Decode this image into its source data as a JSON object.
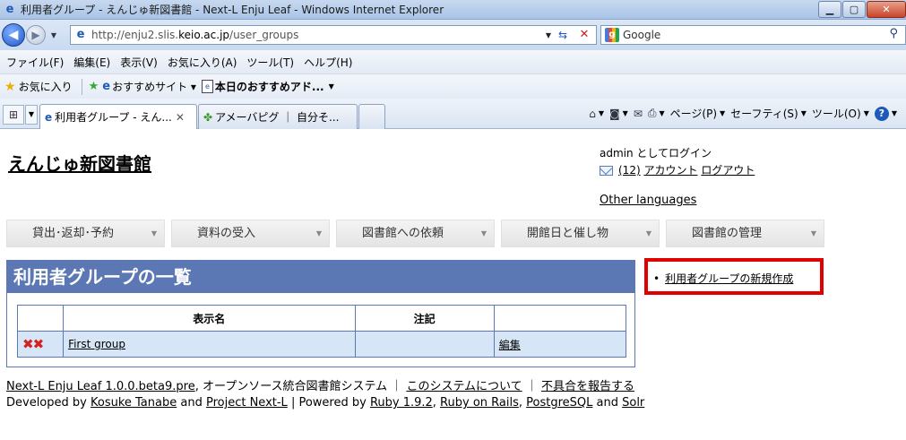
{
  "window": {
    "title": "利用者グループ - えんじゅ新図書館 - Next-L Enju Leaf - Windows Internet Explorer",
    "min_label": "▁",
    "max_label": "▢",
    "close_label": "✕"
  },
  "address": {
    "url_prefix": "http://enju2.slis.",
    "url_domain": "keio.ac.jp",
    "url_path": "/user_groups"
  },
  "search": {
    "placeholder": "Google"
  },
  "menu": [
    "ファイル(F)",
    "編集(E)",
    "表示(V)",
    "お気に入り(A)",
    "ツール(T)",
    "ヘルプ(H)"
  ],
  "favorites": {
    "label": "お気に入り",
    "items": [
      "おすすめサイト ▾",
      "本日のおすすめアド..."
    ]
  },
  "tabs": {
    "active": "利用者グループ - えん...",
    "inactive": "アメーバピグ ｜ 自分そ..."
  },
  "commands": [
    "ページ(P)",
    "セーフティ(S)",
    "ツール(O)"
  ],
  "page": {
    "library_title": "えんじゅ新図書館",
    "login_text": "admin としてログイン",
    "message_count": "(12)",
    "account_link": "アカウント",
    "logout_link": "ログアウト",
    "other_languages": "Other languages",
    "nav": [
      "貸出･返却･予約",
      "資料の受入",
      "図書館への依頼",
      "開館日と催し物",
      "図書館の管理"
    ],
    "heading": "利用者グループの一覧",
    "table": {
      "headers": [
        "",
        "表示名",
        "注記",
        ""
      ],
      "rows": [
        {
          "name": "First group",
          "note": "",
          "edit": "編集"
        }
      ]
    },
    "side_link": "利用者グループの新規作成"
  },
  "footer": {
    "product": "Next-L Enju Leaf 1.0.0.beta9.pre",
    "desc": ", オープンソース統合図書館システム ｜",
    "about": "このシステムについて",
    "sep": " ｜ ",
    "report": "不具合を報告する",
    "dev_prefix": "Developed by ",
    "dev_name": "Kosuke Tanabe",
    "and1": " and ",
    "project": "Project Next-L",
    "powered": " | Powered by ",
    "ruby": "Ruby 1.9.2",
    "comma1": ", ",
    "rails": "Ruby on Rails",
    "comma2": ", ",
    "pg": "PostgreSQL",
    "and2": " and ",
    "solr": "Solr"
  }
}
